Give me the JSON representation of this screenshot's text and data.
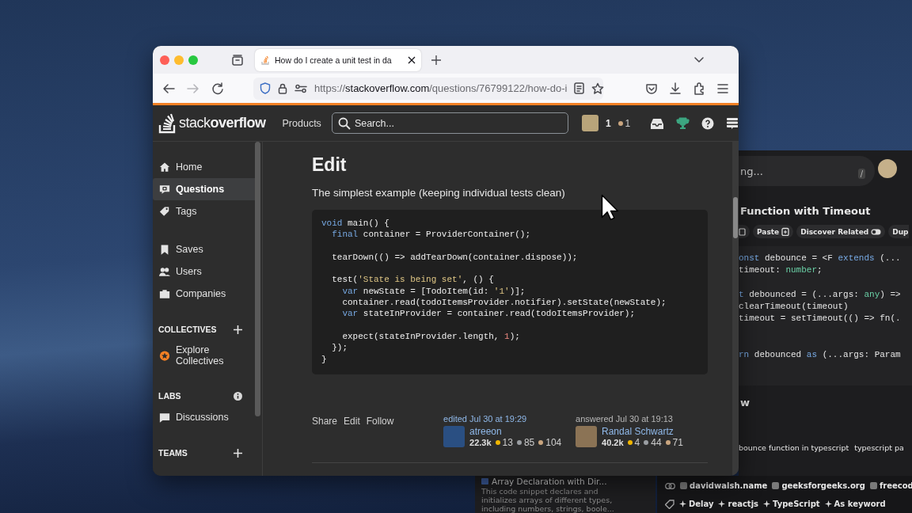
{
  "browser": {
    "tabs": [
      {
        "title": "How do I create a unit test in da",
        "selected": true
      }
    ],
    "nav_buttons": [
      {
        "kind": "back",
        "disabled": false
      },
      {
        "kind": "forward",
        "disabled": true
      },
      {
        "kind": "reload",
        "disabled": false
      }
    ],
    "url": {
      "scheme": "https://",
      "host": "stackoverflow.com",
      "path": "/questions/76799122/how-do-i"
    }
  },
  "site_header": {
    "logo": "stack**overflow**",
    "nav": "Products",
    "search": {
      "placeholder": "Search..."
    },
    "reputation": "1",
    "badges": [
      {
        "count": "1",
        "color": "#c9a57f"
      }
    ]
  },
  "sidebar": {
    "groups": [
      {
        "items": [
          {
            "label": "Home",
            "kind": "home",
            "selected": false
          },
          {
            "label": "Questions",
            "kind": "questions",
            "selected": true
          },
          {
            "label": "Tags",
            "kind": "tags",
            "selected": false
          }
        ]
      },
      {
        "items": [
          {
            "label": "Saves",
            "kind": "saves",
            "selected": false
          },
          {
            "label": "Users",
            "kind": "users",
            "selected": false
          },
          {
            "label": "Companies",
            "kind": "companies",
            "selected": false
          }
        ]
      },
      {
        "heading": "COLLECTIVES",
        "kind": "plus",
        "items": [
          {
            "label": "Explore Collectives",
            "kind": "collective",
            "selected": false
          }
        ]
      },
      {
        "heading": "LABS",
        "kind": "info",
        "items": [
          {
            "label": "Discussions",
            "kind": "discussions",
            "selected": false
          }
        ]
      },
      {
        "heading": "TEAMS",
        "kind": "plus"
      }
    ]
  },
  "post": {
    "heading": "Edit",
    "text": "The simplest example (keeping individual tests clean)",
    "code": [
      {
        "segments": [
          {
            "text": "void",
            "kind": "keyword"
          },
          {
            "text": " main() {",
            "kind": "plain"
          }
        ]
      },
      {
        "segments": [
          {
            "text": "  final",
            "kind": "keyword"
          },
          {
            "text": " container = ProviderContainer();",
            "kind": "plain"
          }
        ]
      },
      {
        "kind": "blank"
      },
      {
        "segments": [
          {
            "text": "  tearDown(() => addTearDown(container.dispose));",
            "kind": "plain"
          }
        ]
      },
      {
        "kind": "blank"
      },
      {
        "segments": [
          {
            "text": "  test(",
            "kind": "plain"
          },
          {
            "text": "'State is being set'",
            "kind": "string"
          },
          {
            "text": ", () {",
            "kind": "plain"
          }
        ]
      },
      {
        "segments": [
          {
            "text": "    var",
            "kind": "keyword"
          },
          {
            "text": " newState = [TodoItem(id: ",
            "kind": "plain"
          },
          {
            "text": "'1'",
            "kind": "string"
          },
          {
            "text": ")];",
            "kind": "plain"
          }
        ]
      },
      {
        "segments": [
          {
            "text": "    container.read(todoItemsProvider.notifier).setState(newState);",
            "kind": "plain"
          }
        ]
      },
      {
        "segments": [
          {
            "text": "    var",
            "kind": "keyword"
          },
          {
            "text": " stateInProvider = container.read(todoItemsProvider);",
            "kind": "plain"
          }
        ]
      },
      {
        "kind": "blank"
      },
      {
        "segments": [
          {
            "text": "    expect(stateInProvider.length, ",
            "kind": "plain"
          },
          {
            "text": "1",
            "kind": "number"
          },
          {
            "text": ");",
            "kind": "plain"
          }
        ]
      },
      {
        "segments": [
          {
            "text": "  });",
            "kind": "plain"
          }
        ]
      },
      {
        "segments": [
          {
            "text": "}",
            "kind": "plain"
          }
        ]
      }
    ],
    "menu": [
      "Share",
      "Edit",
      "Follow"
    ],
    "signatures": [
      {
        "kind": "edited",
        "action": "edited Jul 30 at 19:29",
        "user": "atreeon",
        "reputation": "22.3k",
        "badges": [
          {
            "count": "13",
            "color": "#f1b600"
          },
          {
            "count": "85",
            "color": "#9a9ea2"
          },
          {
            "count": "104",
            "color": "#c9a57f"
          }
        ]
      },
      {
        "kind": "answered",
        "action": "answered Jul 30 at 19:13",
        "user": "Randal Schwartz",
        "reputation": "40.2k",
        "badges": [
          {
            "count": "4",
            "color": "#f1b600"
          },
          {
            "count": "44",
            "color": "#9a9ea2"
          },
          {
            "count": "71",
            "color": "#c9a57f"
          }
        ]
      }
    ]
  },
  "assistant_window": {
    "search": {
      "placeholder": "ng...",
      "shortcut": "/"
    },
    "title": "Function with Timeout",
    "chips": [
      {
        "kind": "icon"
      },
      {
        "kind": "paste",
        "label": "Paste"
      },
      {
        "kind": "toggle",
        "label": "Discover Related"
      },
      {
        "kind": "plain",
        "label": "Dup"
      }
    ],
    "code": [
      {
        "segments": [
          {
            "text": "onst",
            "kind": "keyword"
          },
          {
            "text": " debounce = <F ",
            "kind": "plain"
          },
          {
            "text": "extends",
            "kind": "keyword"
          },
          {
            "text": " (...",
            "kind": "plain"
          }
        ]
      },
      {
        "segments": [
          {
            "text": "timeout: ",
            "kind": "plain"
          },
          {
            "text": "number",
            "kind": "type"
          },
          {
            "text": ";",
            "kind": "plain"
          }
        ]
      },
      {
        "kind": "blank"
      },
      {
        "segments": [
          {
            "text": "t",
            "kind": "keyword"
          },
          {
            "text": " debounced = (...args: ",
            "kind": "plain"
          },
          {
            "text": "any",
            "kind": "type"
          },
          {
            "text": ") =>",
            "kind": "plain"
          }
        ]
      },
      {
        "segments": [
          {
            "text": "clearTimeout(timeout)",
            "kind": "plain"
          }
        ]
      },
      {
        "segments": [
          {
            "text": "timeout = setTimeout(() => fn(.",
            "kind": "plain"
          }
        ]
      },
      {
        "kind": "blank"
      },
      {
        "kind": "blank"
      },
      {
        "segments": [
          {
            "text": "rn",
            "kind": "keyword"
          },
          {
            "text": " debounced ",
            "kind": "plain"
          },
          {
            "text": "as",
            "kind": "keyword"
          },
          {
            "text": " (...args: Param",
            "kind": "plain"
          }
        ]
      }
    ],
    "section_heading": "w",
    "queries": [
      "bounce function in typescript",
      "typescript pa"
    ]
  },
  "related": {
    "sources": [
      "davidwalsh.name",
      "geeksforgeeks.org",
      "freecod"
    ],
    "tags": [
      "Delay",
      "reactjs",
      "TypeScript",
      "As keyword"
    ]
  },
  "snippet_card": {
    "title": "Array Declaration with Dir...",
    "description": "This code snippet declares and initializes arrays of different types, including numbers, strings, boole..."
  }
}
